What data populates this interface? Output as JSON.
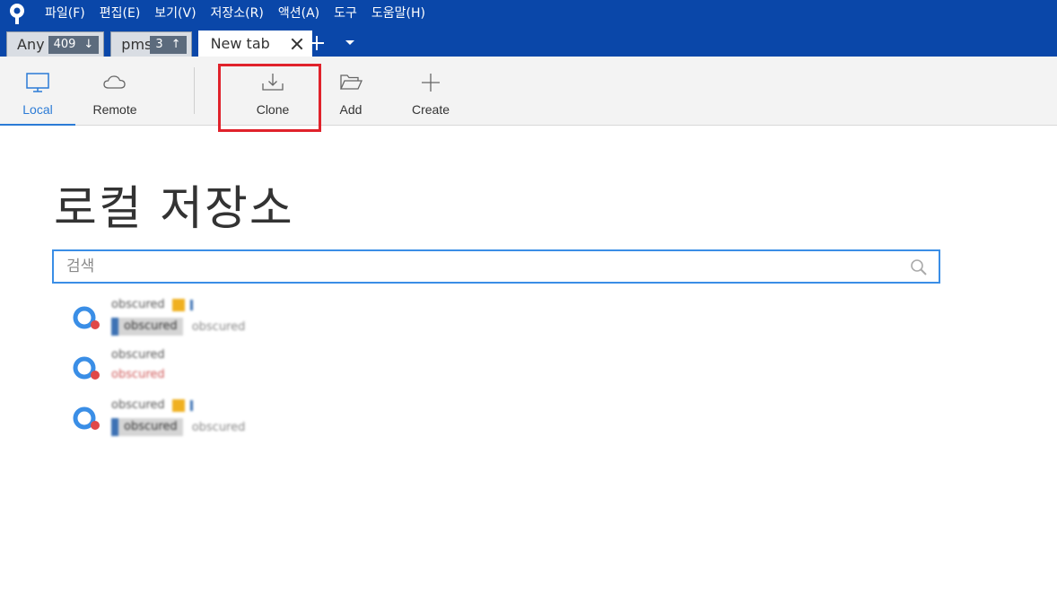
{
  "menu": [
    "파일(F)",
    "편집(E)",
    "보기(V)",
    "저장소(R)",
    "액션(A)",
    "도구",
    "도움말(H)"
  ],
  "tabs": [
    {
      "label": "Any",
      "count": "409",
      "arrow": "↓"
    },
    {
      "label": "pms",
      "count": "3",
      "arrow": "↑"
    },
    {
      "label": "New tab"
    }
  ],
  "toolbar": {
    "local": "Local",
    "remote": "Remote",
    "clone": "Clone",
    "add": "Add",
    "create": "Create"
  },
  "page_title": "로컬 저장소",
  "search": {
    "placeholder": "검색"
  },
  "repositories": [
    {
      "name": "obscured",
      "branch": "obscured",
      "status": "obscured"
    },
    {
      "name": "obscured",
      "status": "obscured"
    },
    {
      "name": "obscured",
      "branch": "obscured",
      "status": "obscured"
    }
  ],
  "colors": {
    "titlebar": "#0a47a9",
    "accent": "#2b7bd6",
    "highlight": "#e0222b"
  }
}
